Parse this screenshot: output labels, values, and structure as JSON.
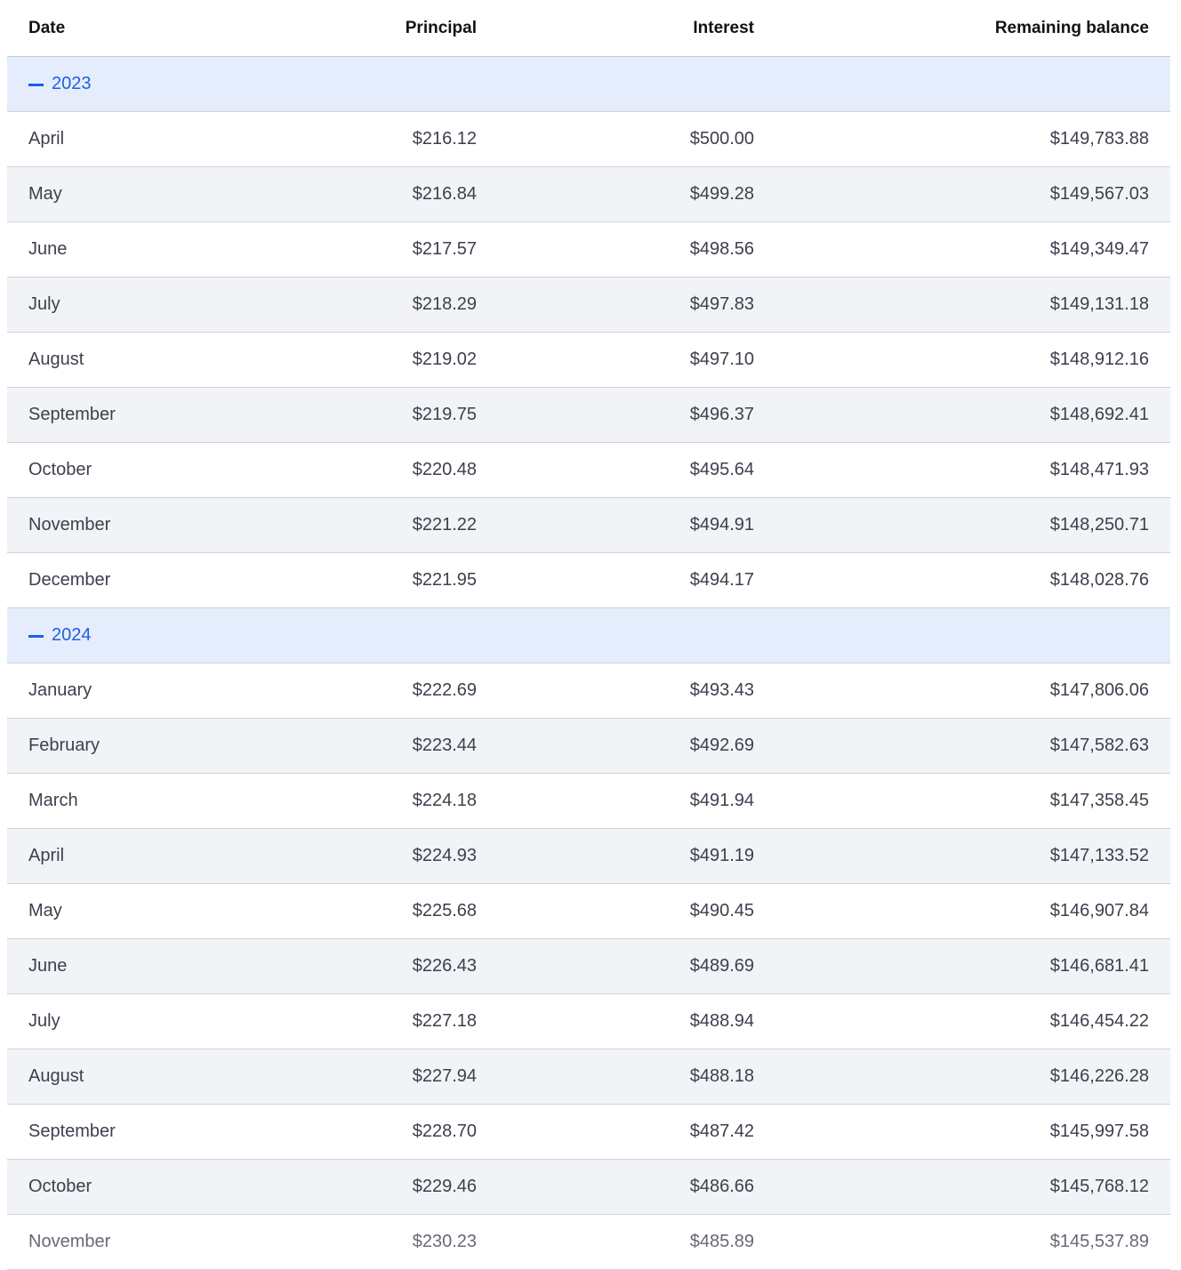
{
  "columns": {
    "date": "Date",
    "principal": "Principal",
    "interest": "Interest",
    "balance": "Remaining balance"
  },
  "colors": {
    "year_row_bg": "#e5edfd",
    "year_text": "#1d5fe0",
    "alt_row_bg": "#f2f3f7",
    "border": "#cdd2db"
  },
  "groups": [
    {
      "year": "2023",
      "toggle_icon": "minus-icon",
      "rows": [
        {
          "date": "April",
          "principal": "$216.12",
          "interest": "$500.00",
          "balance": "$149,783.88"
        },
        {
          "date": "May",
          "principal": "$216.84",
          "interest": "$499.28",
          "balance": "$149,567.03"
        },
        {
          "date": "June",
          "principal": "$217.57",
          "interest": "$498.56",
          "balance": "$149,349.47"
        },
        {
          "date": "July",
          "principal": "$218.29",
          "interest": "$497.83",
          "balance": "$149,131.18"
        },
        {
          "date": "August",
          "principal": "$219.02",
          "interest": "$497.10",
          "balance": "$148,912.16"
        },
        {
          "date": "September",
          "principal": "$219.75",
          "interest": "$496.37",
          "balance": "$148,692.41"
        },
        {
          "date": "October",
          "principal": "$220.48",
          "interest": "$495.64",
          "balance": "$148,471.93"
        },
        {
          "date": "November",
          "principal": "$221.22",
          "interest": "$494.91",
          "balance": "$148,250.71"
        },
        {
          "date": "December",
          "principal": "$221.95",
          "interest": "$494.17",
          "balance": "$148,028.76"
        }
      ]
    },
    {
      "year": "2024",
      "toggle_icon": "minus-icon",
      "rows": [
        {
          "date": "January",
          "principal": "$222.69",
          "interest": "$493.43",
          "balance": "$147,806.06"
        },
        {
          "date": "February",
          "principal": "$223.44",
          "interest": "$492.69",
          "balance": "$147,582.63"
        },
        {
          "date": "March",
          "principal": "$224.18",
          "interest": "$491.94",
          "balance": "$147,358.45"
        },
        {
          "date": "April",
          "principal": "$224.93",
          "interest": "$491.19",
          "balance": "$147,133.52"
        },
        {
          "date": "May",
          "principal": "$225.68",
          "interest": "$490.45",
          "balance": "$146,907.84"
        },
        {
          "date": "June",
          "principal": "$226.43",
          "interest": "$489.69",
          "balance": "$146,681.41"
        },
        {
          "date": "July",
          "principal": "$227.18",
          "interest": "$488.94",
          "balance": "$146,454.22"
        },
        {
          "date": "August",
          "principal": "$227.94",
          "interest": "$488.18",
          "balance": "$146,226.28"
        },
        {
          "date": "September",
          "principal": "$228.70",
          "interest": "$487.42",
          "balance": "$145,997.58"
        },
        {
          "date": "October",
          "principal": "$229.46",
          "interest": "$486.66",
          "balance": "$145,768.12"
        },
        {
          "date": "November",
          "principal": "$230.23",
          "interest": "$485.89",
          "balance": "$145,537.89"
        }
      ]
    }
  ]
}
